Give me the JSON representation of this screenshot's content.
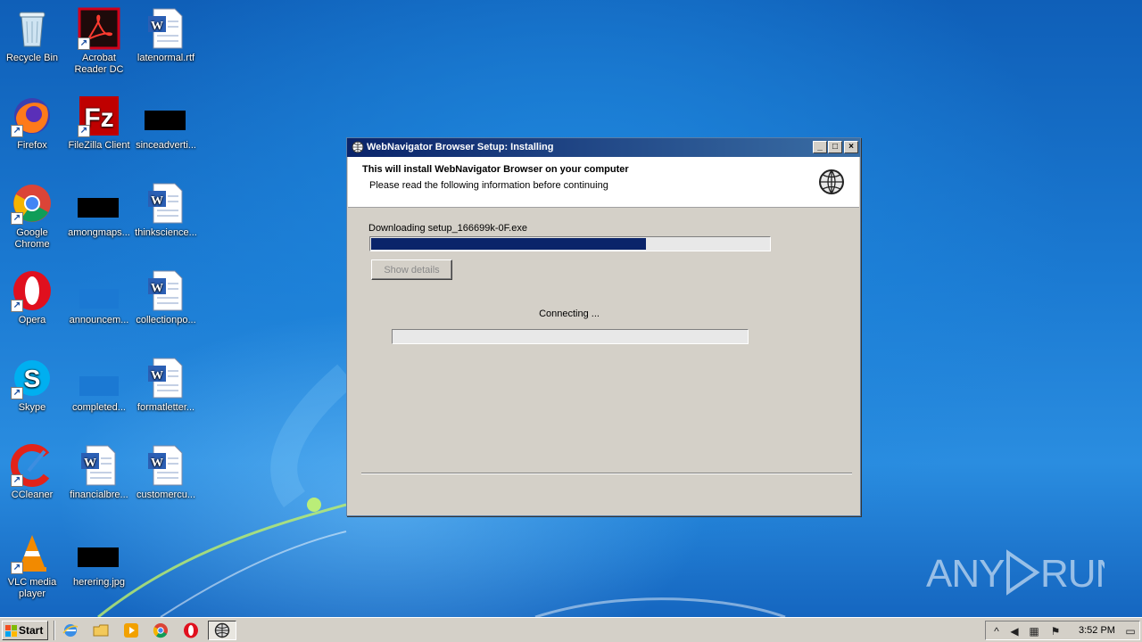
{
  "desktop": {
    "icons": [
      {
        "label": "Recycle Bin"
      },
      {
        "label": "Acrobat Reader DC"
      },
      {
        "label": "latenormal.rtf"
      },
      {
        "label": "Firefox"
      },
      {
        "label": "FileZilla Client"
      },
      {
        "label": "sinceadverti..."
      },
      {
        "label": "Google Chrome"
      },
      {
        "label": "amongmaps..."
      },
      {
        "label": "thinkscience..."
      },
      {
        "label": "Opera"
      },
      {
        "label": "announcem..."
      },
      {
        "label": "collectionpo..."
      },
      {
        "label": "Skype"
      },
      {
        "label": "completed..."
      },
      {
        "label": "formatletter..."
      },
      {
        "label": "CCleaner"
      },
      {
        "label": "financialbre..."
      },
      {
        "label": "customercu..."
      },
      {
        "label": "VLC media player"
      },
      {
        "label": "herering.jpg"
      }
    ]
  },
  "setup_window": {
    "title": "WebNavigator Browser Setup: Installing",
    "minimize_label": "_",
    "maximize_label": "□",
    "close_label": "×",
    "header_title": "This will install WebNavigator Browser on your computer",
    "header_subtitle": "Please read the following information before continuing",
    "download_label": "Downloading setup_166699k-0F.exe",
    "download_progress": 0.69,
    "show_details_label": "Show details",
    "connecting_label": "Connecting ...",
    "connect_progress": 0
  },
  "watermark": {
    "text": "ANY RUN"
  },
  "taskbar": {
    "start_label": "Start",
    "clock": "3:52 PM"
  },
  "colors": {
    "titlebar_start": "#0a246a",
    "titlebar_end": "#3a6ea5",
    "progress_fill": "#0a246a",
    "window_face": "#d4d0c8"
  }
}
